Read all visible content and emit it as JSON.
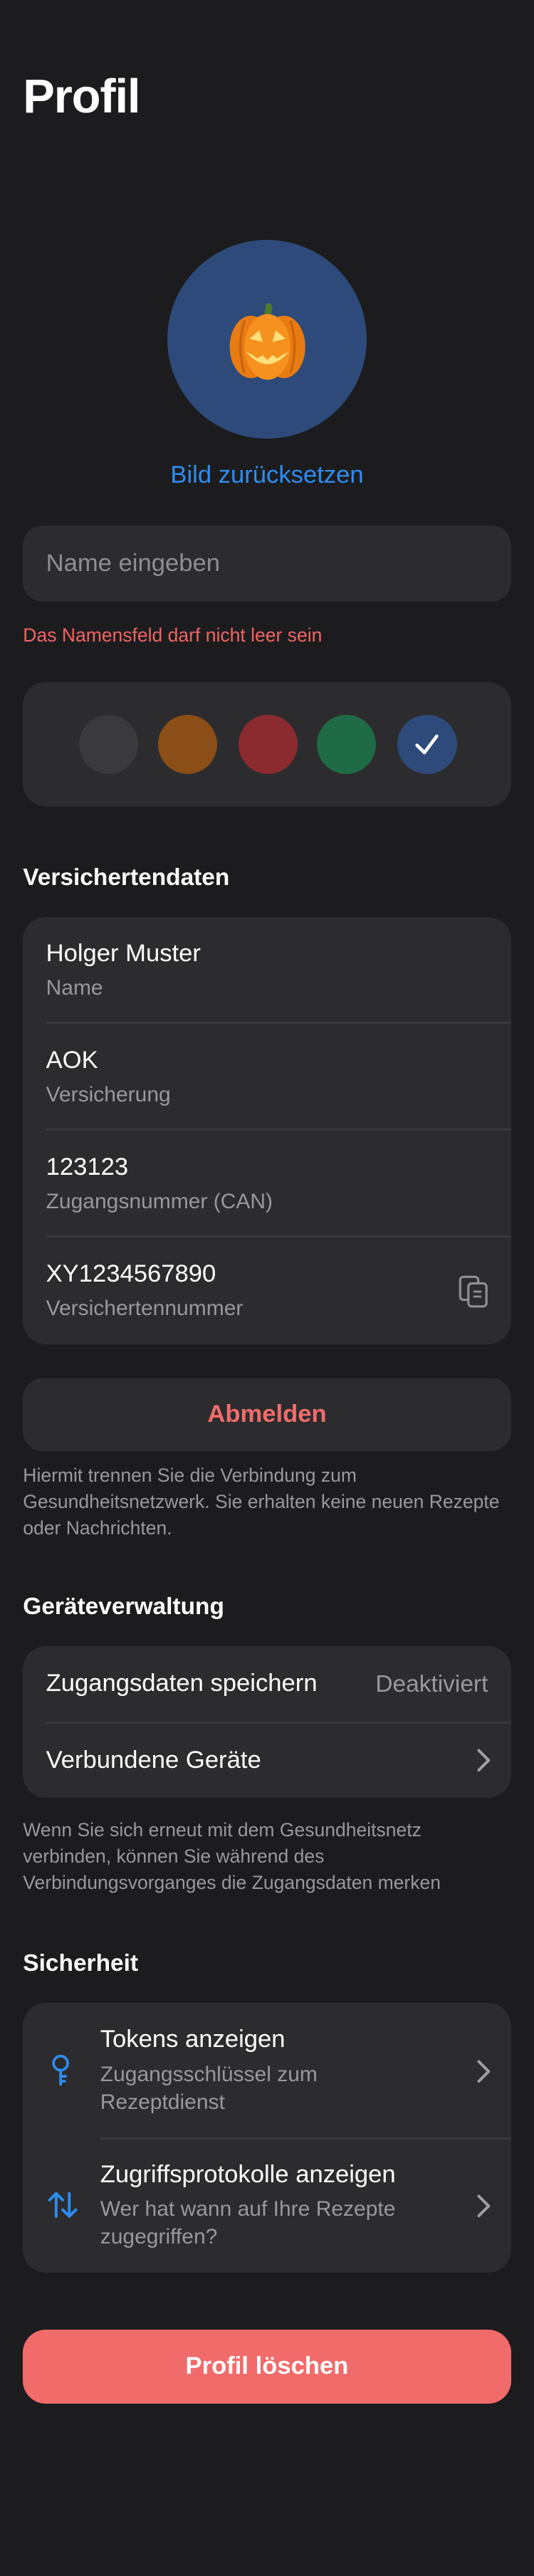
{
  "header": {
    "title": "Profil"
  },
  "avatar": {
    "icon": "pumpkin-icon",
    "background": "#2d4a7a",
    "reset_label": "Bild zurücksetzen"
  },
  "name_input": {
    "value": "",
    "placeholder": "Name eingeben",
    "error": "Das Namensfeld darf nicht leer sein"
  },
  "color_picker": {
    "colors": [
      "#3a3a3c",
      "#8a4e16",
      "#8b2a2f",
      "#1f6b46",
      "#2d4a7a"
    ],
    "selected_index": 4
  },
  "insurance": {
    "header": "Versichertendaten",
    "rows": [
      {
        "value": "Holger Muster",
        "label": "Name"
      },
      {
        "value": "AOK",
        "label": "Versicherung"
      },
      {
        "value": "123123",
        "label": "Zugangsnummer (CAN)"
      },
      {
        "value": "XY1234567890",
        "label": "Versichertennummer",
        "icon": "copy-icon"
      }
    ]
  },
  "logout": {
    "label": "Abmelden",
    "note_lines": [
      "Hiermit trennen Sie die Verbindung zum",
      "Gesundheitsnetzwerk. Sie erhalten keine neuen Rezepte",
      "oder Nachrichten."
    ]
  },
  "devices": {
    "header": "Geräteverwaltung",
    "save_label": "Zugangsdaten speichern",
    "save_value": "Deaktiviert",
    "connected_label": "Verbundene Geräte",
    "note_lines": [
      "Wenn Sie sich erneut mit dem Gesundheitsnetz",
      "verbinden, können Sie während des",
      "Verbindungsvorganges die Zugangsdaten merken"
    ]
  },
  "security": {
    "header": "Sicherheit",
    "items": [
      {
        "title": "Tokens anzeigen",
        "subtitle_lines": [
          "Zugangsschlüssel zum",
          "Rezeptdienst"
        ],
        "icon": "key-icon"
      },
      {
        "title": "Zugriffsprotokolle anzeigen",
        "subtitle_lines": [
          "Wer hat wann auf Ihre Rezepte",
          "zugegriffen?"
        ],
        "icon": "arrows-icon"
      }
    ]
  },
  "delete": {
    "label": "Profil löschen"
  },
  "colors": {
    "background": "#1c1c1e",
    "card": "#2c2c2e",
    "accent": "#2f8cf0",
    "danger": "#f26b6b"
  }
}
